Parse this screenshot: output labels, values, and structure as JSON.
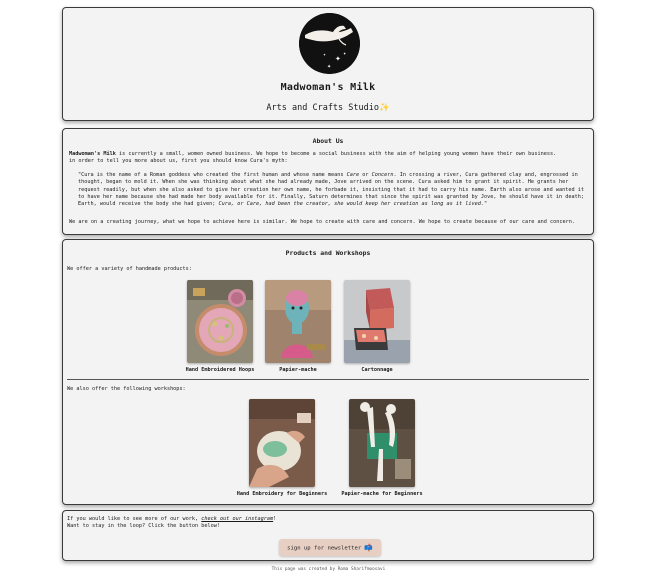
{
  "header": {
    "title": "Madwoman's Milk",
    "subtitle": "Arts and Crafts Studio",
    "subtitle_emoji": "✨"
  },
  "about": {
    "title": "About Us",
    "intro_brand": "Madwoman's Milk",
    "intro_rest": " is currently a small, women owned business. We hope to become a social business with the aim of helping young women have their own business.",
    "intro_line2": "in order to tell you more about us, first you should know Cura's myth:",
    "quote_part1": "\"Cura is the name of a Roman goddess who created the first human and whose name means ",
    "quote_care": "Care",
    "quote_or": " or ",
    "quote_concern": "Concern",
    "quote_part2": ". In crossing a river, Cura gathered clay and, engrossed in thought, began to mold it. When she was thinking about what she had already made, Jove arrived on the scene. Cura asked him to grant it spirit. He grants her request readily, but when she also asked to give her creation her own name, he forbade it, insisting that it had to carry his name. Earth also arose and wanted it to have her name because she had made her body available for it. Finally, Saturn determines that since the spirit was granted by Jove, he should have it in death; Earth, would receive the body she had given; ",
    "quote_end": "Cura, or Care, had been the creator, she would keep her creation as long as it lived.",
    "quote_close": "\"",
    "closing": "We are on a creating journey, what we hope to achieve here is similar. We hope to create with care and concern. We hope to create because of our care and concern."
  },
  "products": {
    "title": "Products and Workshops",
    "intro": "We offer a variety of handmade products:",
    "items": [
      {
        "label": "Hand Embroidered Hoops"
      },
      {
        "label": "Papier-mache"
      },
      {
        "label": "Cartonnage"
      }
    ],
    "workshops_intro": "We also offer the following workshops:",
    "workshops": [
      {
        "label": "Hand Embroidery for Beginners"
      },
      {
        "label": "Papier-mache for Beginners"
      }
    ]
  },
  "social": {
    "line1_prefix": "If you would like to see more of our work, ",
    "line1_link": "check out our instagram",
    "line1_suffix": "!",
    "line2": "Want to stay in the loop? Click the button below!",
    "button_label": "sign up for newsletter",
    "button_emoji": "📫"
  },
  "footer": {
    "credit": "This page was created by Roma Sharifmoosavi"
  },
  "colors": {
    "card_bg": "#f3f3f3",
    "button_bg": "#e8cfc3",
    "sparkle": "#f2c84b"
  }
}
